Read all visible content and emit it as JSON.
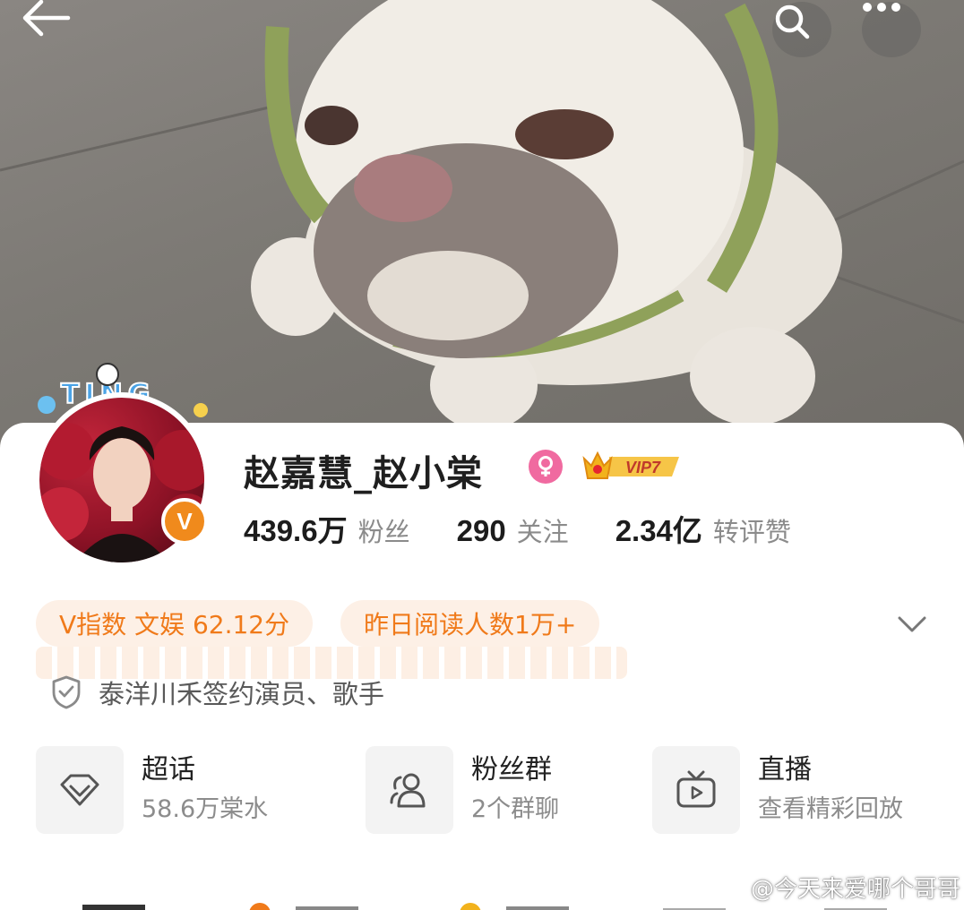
{
  "header": {
    "back_icon": "back-arrow-icon",
    "search_icon": "search-icon",
    "more_icon": "more-dots-icon"
  },
  "profile": {
    "name": "赵嘉慧_赵小棠",
    "gender_icon": "female-icon",
    "vip_label": "VIP7",
    "verified_badge": "V",
    "avatar_frame_text": "TING",
    "stats": [
      {
        "value": "439.6万",
        "label": "粉丝"
      },
      {
        "value": "290",
        "label": "关注"
      },
      {
        "value": "2.34亿",
        "label": "转评赞"
      }
    ],
    "chips": [
      "V指数 文娱 62.12分",
      "昨日阅读人数1万+"
    ],
    "certification": "泰洋川禾签约演员、歌手"
  },
  "features": [
    {
      "title": "超话",
      "subtitle": "58.6万棠水",
      "icon": "diamond-icon"
    },
    {
      "title": "粉丝群",
      "subtitle": "2个群聊",
      "icon": "group-icon"
    },
    {
      "title": "直播",
      "subtitle": "查看精彩回放",
      "icon": "tv-icon"
    }
  ],
  "watermark": "@今天来爱哪个哥哥",
  "colors": {
    "accent_orange": "#f07a1a",
    "chip_bg": "#fdf0e6",
    "gender_pink": "#f06aa0",
    "vip_gold": "#f2b21c"
  }
}
